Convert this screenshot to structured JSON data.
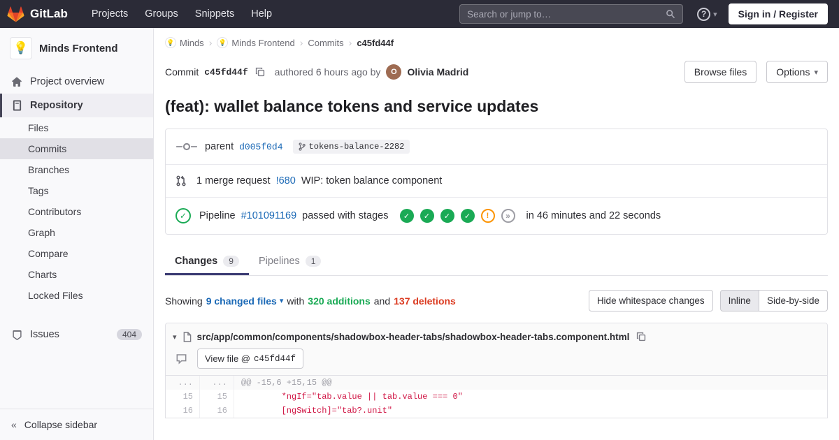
{
  "icons": {
    "check": "✓",
    "warning": "!",
    "skipped": "»",
    "caret_down": "▾",
    "chevron_right": "›",
    "collapse": "«",
    "bulb": "💡",
    "question": "?"
  },
  "colors": {
    "navbar_bg": "#2b2b37",
    "brand_orange": "#fc6d26",
    "link_blue": "#1b69b6",
    "success_green": "#1aaa55",
    "danger_red": "#db3b21",
    "warning_orange": "#fc9403",
    "active_tab_indigo": "#3c3c74"
  },
  "navbar": {
    "brand": "GitLab",
    "menu": [
      {
        "label": "Projects"
      },
      {
        "label": "Groups"
      },
      {
        "label": "Snippets"
      },
      {
        "label": "Help"
      }
    ],
    "search": {
      "placeholder": "Search or jump to…"
    },
    "sign_in": "Sign in / Register"
  },
  "sidebar": {
    "project": {
      "name": "Minds Frontend"
    },
    "overview_label": "Project overview",
    "repository_label": "Repository",
    "repo_items": [
      {
        "label": "Files"
      },
      {
        "label": "Commits"
      },
      {
        "label": "Branches"
      },
      {
        "label": "Tags"
      },
      {
        "label": "Contributors"
      },
      {
        "label": "Graph"
      },
      {
        "label": "Compare"
      },
      {
        "label": "Charts"
      },
      {
        "label": "Locked Files"
      }
    ],
    "issues": {
      "label": "Issues",
      "count": "404"
    },
    "collapse_label": "Collapse sidebar"
  },
  "breadcrumb": {
    "items": [
      {
        "label": "Minds"
      },
      {
        "label": "Minds Frontend"
      },
      {
        "label": "Commits"
      },
      {
        "label": "c45fd44f"
      }
    ]
  },
  "commit": {
    "label": "Commit",
    "sha": "c45fd44f",
    "authored": "authored 6 hours ago by",
    "author": "Olivia Madrid",
    "author_initial": "O",
    "browse_files": "Browse files",
    "options": "Options",
    "title": "(feat): wallet balance tokens and service updates",
    "parent_label": "parent",
    "parent_sha": "d005f0d4",
    "branch": "tokens-balance-2282",
    "merge_requests": "1 merge request",
    "mr_ref": "!680",
    "mr_title": "WIP: token balance component",
    "pipeline_label": "Pipeline",
    "pipeline_id": "#101091169",
    "pipeline_status": "passed with stages",
    "pipeline_stages": [
      "success",
      "success",
      "success",
      "success",
      "warning",
      "skipped"
    ],
    "pipeline_duration": "in 46 minutes and 22 seconds"
  },
  "tabs": [
    {
      "label": "Changes",
      "count": "9"
    },
    {
      "label": "Pipelines",
      "count": "1"
    }
  ],
  "summary": {
    "showing": "Showing",
    "files_dropdown": "9 changed files",
    "with": "with",
    "additions": "320 additions",
    "and": "and",
    "deletions": "137 deletions",
    "hide_whitespace": "Hide whitespace changes",
    "inline": "Inline",
    "side_by_side": "Side-by-side"
  },
  "diff": {
    "file_path": "src/app/common/components/shadowbox-header-tabs/shadowbox-header-tabs.component.html",
    "view_file_label": "View file @",
    "view_file_sha": "c45fd44f",
    "lines": [
      {
        "old": "...",
        "new": "...",
        "code": "@@ -15,6 +15,15 @@"
      },
      {
        "old": "15",
        "new": "15",
        "code": "        *ngIf=\"tab.value || tab.value === 0\""
      },
      {
        "old": "16",
        "new": "16",
        "code": "        [ngSwitch]=\"tab?.unit\""
      }
    ]
  }
}
